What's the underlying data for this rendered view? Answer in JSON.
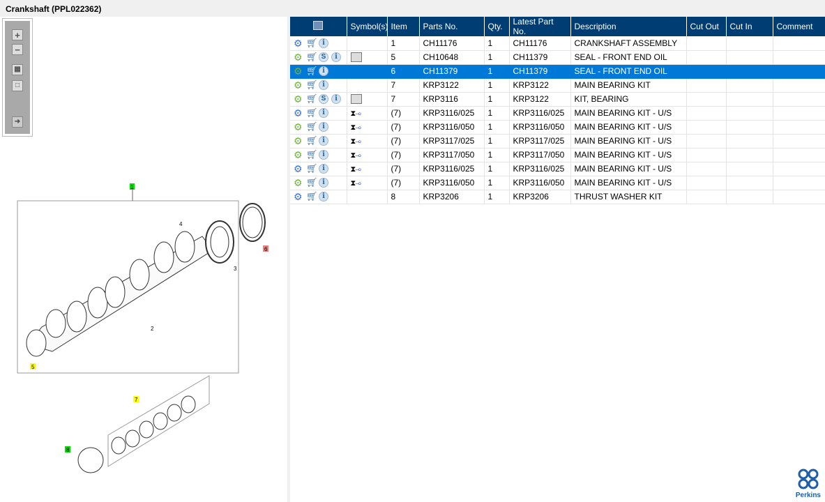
{
  "window": {
    "title": "Crankshaft (PPL022362)"
  },
  "toolbar": {
    "zoom_in": "+",
    "zoom_out": "−"
  },
  "diagram": {
    "callouts": [
      "1",
      "2",
      "3",
      "4",
      "5",
      "6",
      "7",
      "8"
    ]
  },
  "table": {
    "headers": [
      "",
      "Symbol(s)",
      "Item",
      "Parts No.",
      "Qty.",
      "Latest Part No.",
      "Description",
      "Cut Out",
      "Cut In",
      "Comment"
    ],
    "rows": [
      {
        "gear": "multi",
        "s": false,
        "symbol": "",
        "item": "1",
        "part": "CH11176",
        "qty": "1",
        "latest": "CH11176",
        "desc": "CRANKSHAFT ASSEMBLY",
        "cut_out": "",
        "cut_in": "",
        "comment": ""
      },
      {
        "gear": "single",
        "s": true,
        "symbol": "book",
        "item": "5",
        "part": "CH10648",
        "qty": "1",
        "latest": "CH11379",
        "desc": "SEAL - FRONT END OIL",
        "cut_out": "",
        "cut_in": "",
        "comment": ""
      },
      {
        "gear": "single",
        "s": false,
        "symbol": "",
        "item": "6",
        "part": "CH11379",
        "qty": "1",
        "latest": "CH11379",
        "desc": "SEAL - FRONT END OIL",
        "cut_out": "",
        "cut_in": "",
        "comment": "",
        "selected": true
      },
      {
        "gear": "single",
        "s": false,
        "symbol": "",
        "item": "7",
        "part": "KRP3122",
        "qty": "1",
        "latest": "KRP3122",
        "desc": "MAIN BEARING KIT",
        "cut_out": "",
        "cut_in": "",
        "comment": ""
      },
      {
        "gear": "single",
        "s": true,
        "symbol": "book",
        "item": "7",
        "part": "KRP3116",
        "qty": "1",
        "latest": "KRP3122",
        "desc": "KIT, BEARING",
        "cut_out": "",
        "cut_in": "",
        "comment": ""
      },
      {
        "gear": "multi",
        "s": false,
        "symbol": "undersize",
        "item": "(7)",
        "part": "KRP3116/025",
        "qty": "1",
        "latest": "KRP3116/025",
        "desc": "MAIN BEARING KIT - U/S",
        "cut_out": "",
        "cut_in": "",
        "comment": ""
      },
      {
        "gear": "single",
        "s": false,
        "symbol": "undersize",
        "item": "(7)",
        "part": "KRP3116/050",
        "qty": "1",
        "latest": "KRP3116/050",
        "desc": "MAIN BEARING KIT - U/S",
        "cut_out": "",
        "cut_in": "",
        "comment": ""
      },
      {
        "gear": "single",
        "s": false,
        "symbol": "undersize",
        "item": "(7)",
        "part": "KRP3117/025",
        "qty": "1",
        "latest": "KRP3117/025",
        "desc": "MAIN BEARING KIT - U/S",
        "cut_out": "",
        "cut_in": "",
        "comment": ""
      },
      {
        "gear": "single",
        "s": false,
        "symbol": "undersize",
        "item": "(7)",
        "part": "KRP3117/050",
        "qty": "1",
        "latest": "KRP3117/050",
        "desc": "MAIN BEARING KIT - U/S",
        "cut_out": "",
        "cut_in": "",
        "comment": ""
      },
      {
        "gear": "multi",
        "s": false,
        "symbol": "undersize",
        "item": "(7)",
        "part": "KRP3116/025",
        "qty": "1",
        "latest": "KRP3116/025",
        "desc": "MAIN BEARING KIT - U/S",
        "cut_out": "",
        "cut_in": "",
        "comment": ""
      },
      {
        "gear": "single",
        "s": false,
        "symbol": "undersize",
        "item": "(7)",
        "part": "KRP3116/050",
        "qty": "1",
        "latest": "KRP3116/050",
        "desc": "MAIN BEARING KIT - U/S",
        "cut_out": "",
        "cut_in": "",
        "comment": ""
      },
      {
        "gear": "multi",
        "s": false,
        "symbol": "",
        "item": "8",
        "part": "KRP3206",
        "qty": "1",
        "latest": "KRP3206",
        "desc": "THRUST WASHER KIT",
        "cut_out": "",
        "cut_in": "",
        "comment": ""
      }
    ]
  },
  "logo": {
    "text": "Perkins"
  },
  "colors": {
    "header": "#003d73",
    "selected": "#0078d7",
    "accent_green": "#6cb33f"
  }
}
